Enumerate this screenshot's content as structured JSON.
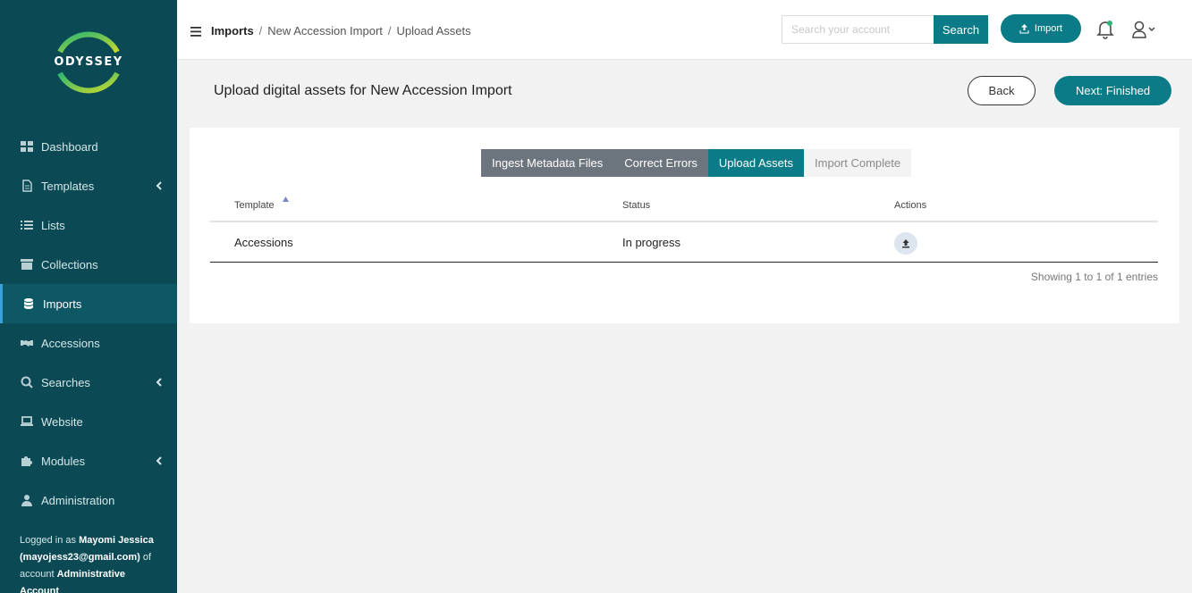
{
  "sidebar": {
    "logo_text": "ODYSSEY",
    "items": [
      {
        "label": "Dashboard",
        "icon": "dashboard-icon",
        "expandable": false
      },
      {
        "label": "Templates",
        "icon": "file-icon",
        "expandable": true
      },
      {
        "label": "Lists",
        "icon": "list-icon",
        "expandable": false
      },
      {
        "label": "Collections",
        "icon": "archive-box-icon",
        "expandable": false
      },
      {
        "label": "Imports",
        "icon": "database-icon",
        "expandable": false,
        "active": true
      },
      {
        "label": "Accessions",
        "icon": "handshake-icon",
        "expandable": false
      },
      {
        "label": "Searches",
        "icon": "search-icon",
        "expandable": true
      },
      {
        "label": "Website",
        "icon": "laptop-icon",
        "expandable": false
      },
      {
        "label": "Modules",
        "icon": "puzzle-icon",
        "expandable": true
      },
      {
        "label": "Administration",
        "icon": "user-icon",
        "expandable": false
      }
    ],
    "login": {
      "prefix": "Logged in as ",
      "name": "Mayomi Jessica",
      "email": "(mayojess23@gmail.com)",
      "mid": " of account ",
      "account": "Administrative Account"
    }
  },
  "header": {
    "breadcrumb": [
      "Imports",
      "New Accession Import",
      "Upload Assets"
    ],
    "search_placeholder": "Search your account",
    "search_label": "Search",
    "import_label": "Import"
  },
  "page": {
    "title": "Upload digital assets for New Accession Import",
    "back_label": "Back",
    "next_label": "Next: Finished"
  },
  "steps": [
    {
      "label": "Ingest Metadata Files",
      "state": "done"
    },
    {
      "label": "Correct Errors",
      "state": "done"
    },
    {
      "label": "Upload Assets",
      "state": "current"
    },
    {
      "label": "Import Complete",
      "state": "pending"
    }
  ],
  "table": {
    "columns": [
      "Template",
      "Status",
      "Actions"
    ],
    "rows": [
      {
        "template": "Accessions",
        "status": "In progress",
        "action_icon": "upload-icon"
      }
    ],
    "footer": "Showing 1 to 1 of 1 entries"
  },
  "colors": {
    "sidebar_bg": "#0b4a55",
    "accent": "#0b7c87",
    "step_done": "#6c757d",
    "logo_ring_start": "#2bb673",
    "logo_ring_end": "#c5d92d"
  }
}
